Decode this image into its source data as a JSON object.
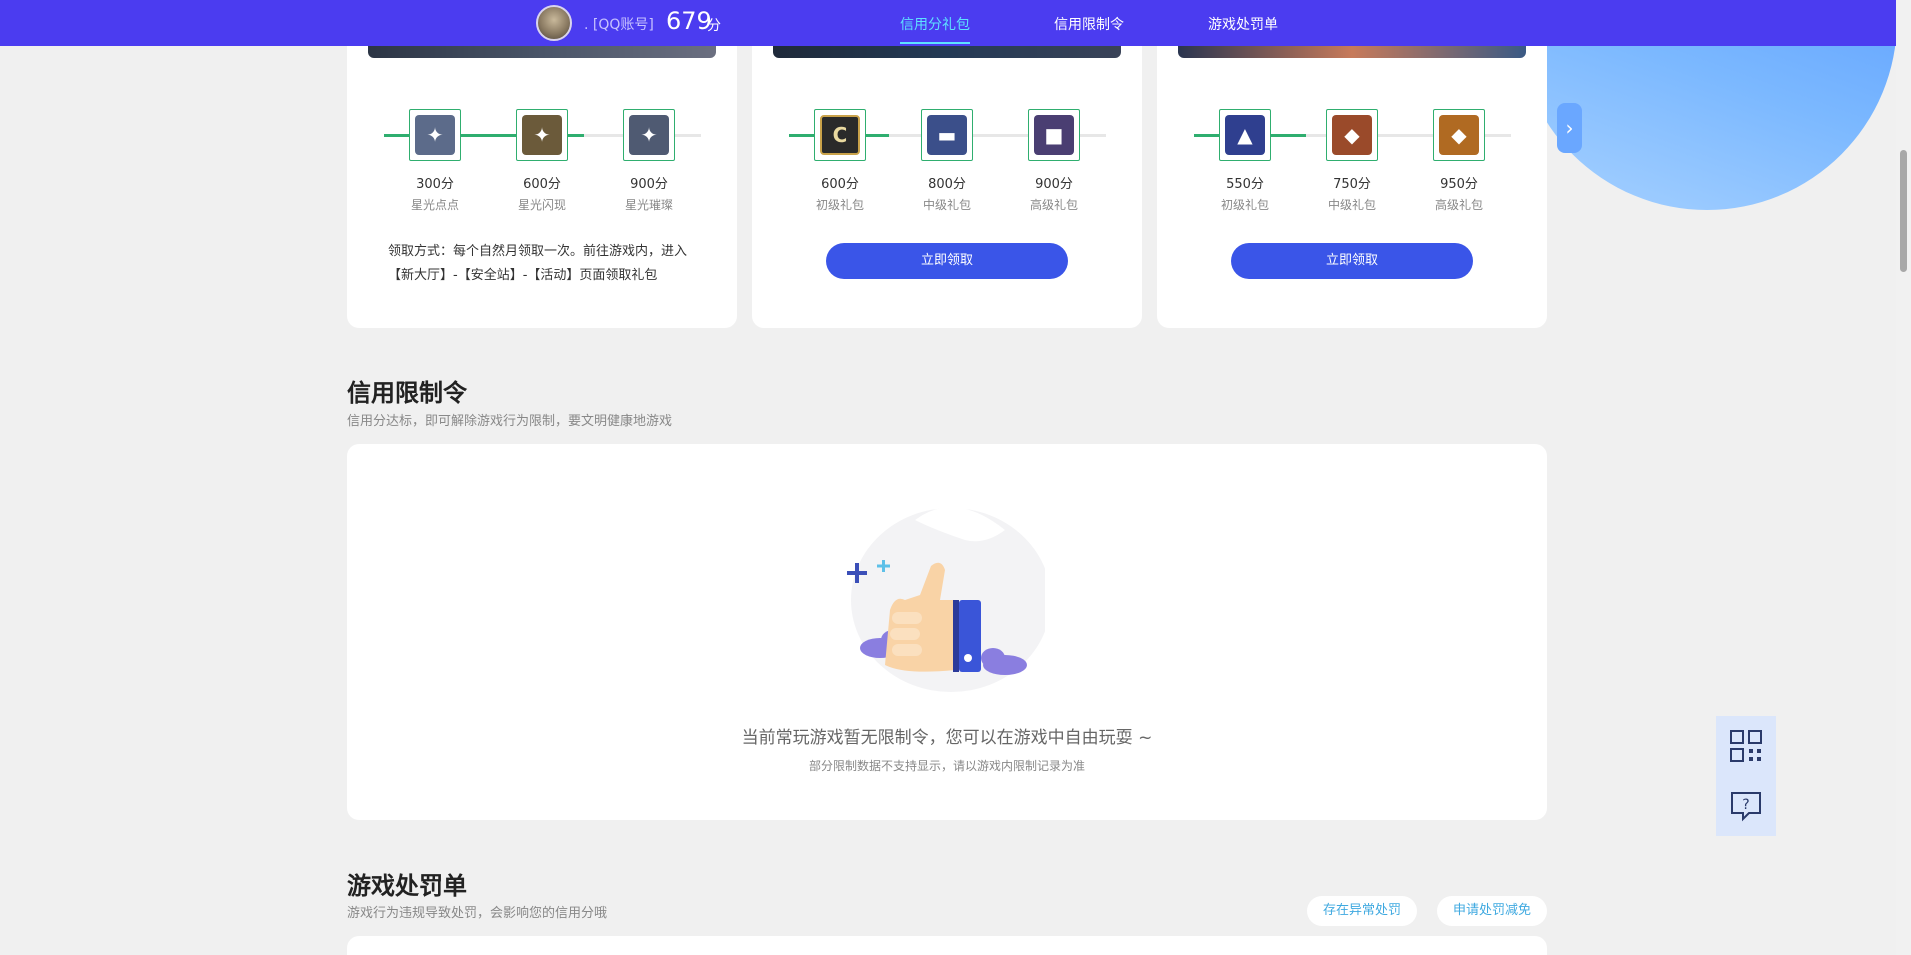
{
  "header": {
    "account": ". [QQ账号]",
    "score": "679",
    "score_unit": "分",
    "nav": [
      "信用分礼包",
      "信用限制令",
      "游戏处罚单"
    ]
  },
  "gift_cards": [
    {
      "tiers": [
        {
          "points": "300分",
          "name": "星光点点",
          "color": "#5c6b8a"
        },
        {
          "points": "600分",
          "name": "星光闪现",
          "color": "#6b5a3a"
        },
        {
          "points": "900分",
          "name": "星光璀璨",
          "color": "#4f5a72"
        }
      ],
      "progress": 0.55,
      "claim_text": "领取方式：每个自然月领取一次。前往游戏内，进入【新大厅】-【安全站】-【活动】页面领取礼包"
    },
    {
      "tiers": [
        {
          "points": "600分",
          "name": "初级礼包",
          "color": "#2a2a2a",
          "glyph": "C"
        },
        {
          "points": "800分",
          "name": "中级礼包",
          "color": "#3b4f8a"
        },
        {
          "points": "900分",
          "name": "高级礼包",
          "color": "#4a3e72"
        }
      ],
      "progress": 0.3,
      "button": "立即领取"
    },
    {
      "tiers": [
        {
          "points": "550分",
          "name": "初级礼包",
          "color": "#2f3f8f",
          "glyph": "▲"
        },
        {
          "points": "750分",
          "name": "中级礼包",
          "color": "#9a4a2a",
          "glyph": "◆"
        },
        {
          "points": "950分",
          "name": "高级礼包",
          "color": "#b06a22",
          "glyph": "◆"
        }
      ],
      "progress": 0.35,
      "button": "立即领取"
    }
  ],
  "restriction": {
    "title": "信用限制令",
    "subtitle": "信用分达标，即可解除游戏行为限制，要文明健康地游戏",
    "empty_main": "当前常玩游戏暂无限制令，您可以在游戏中自由玩耍 ~",
    "empty_sub": "部分限制数据不支持显示，请以游戏内限制记录为准"
  },
  "penalty": {
    "title": "游戏处罚单",
    "subtitle": "游戏行为违规导致处罚，会影响您的信用分哦",
    "buttons": [
      "存在异常处罚",
      "申请处罚减免"
    ]
  },
  "icons": {
    "next": "chevron-right-icon",
    "qr": "qr-code-icon",
    "help": "help-chat-icon"
  },
  "colors": {
    "topbar": "#4b3cf0",
    "nav_active": "#5ee2ff",
    "primary_button": "#3a55e8",
    "progress": "#2fae6f"
  }
}
